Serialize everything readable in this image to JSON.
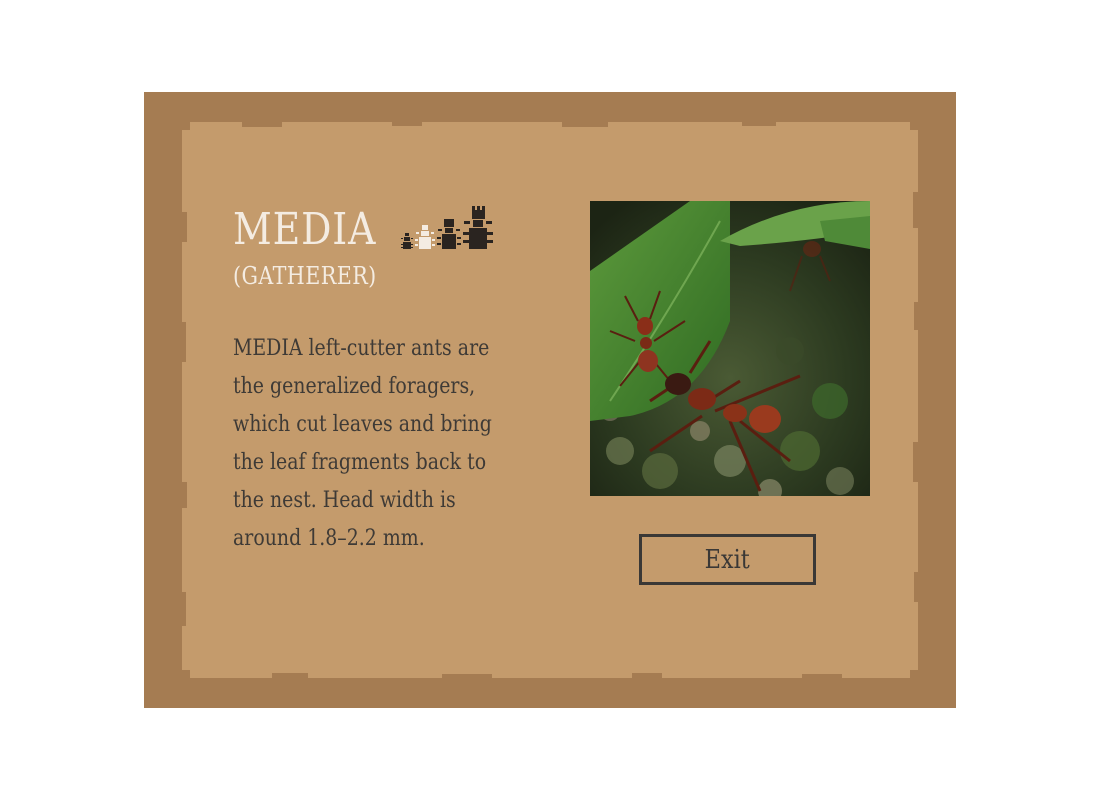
{
  "card": {
    "title": "MEDIA",
    "subtitle": "(GATHERER)",
    "description": "MEDIA left-cutter ants are the generalized foragers, which cut leaves and bring the leaf fragments back to the nest. Head width is around 1.8–2.2 mm.",
    "exit_label": "Exit",
    "photo_icon": "leafcutter-ant-photo"
  },
  "caste_icons": [
    {
      "name": "minima-ant-icon",
      "color": "#2a2420"
    },
    {
      "name": "media-ant-icon",
      "color": "#f4ece2"
    },
    {
      "name": "major-ant-icon",
      "color": "#2a2420"
    },
    {
      "name": "queen-ant-icon",
      "color": "#2a2420"
    }
  ],
  "colors": {
    "panel_border": "#a57c52",
    "panel_fill": "#c49b6c",
    "title": "#f4ece2",
    "text": "#3e3a36"
  }
}
